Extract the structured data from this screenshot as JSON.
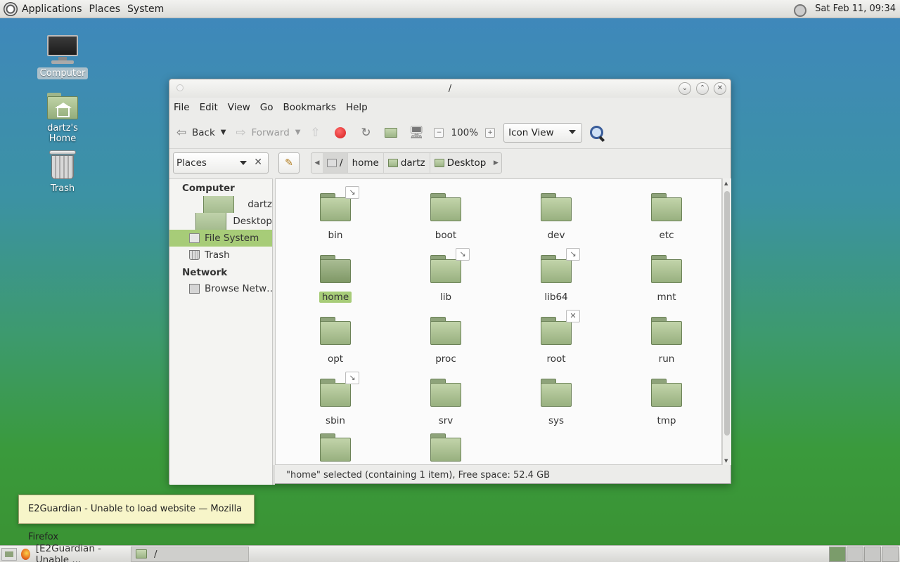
{
  "top_panel": {
    "menus": [
      "Applications",
      "Places",
      "System"
    ],
    "clock": "Sat Feb 11, 09:34"
  },
  "desktop": {
    "icons": [
      {
        "label": "Computer",
        "icon": "computer-icon",
        "selected": true
      },
      {
        "label": "dartz's Home",
        "icon": "home-folder-icon",
        "selected": false
      },
      {
        "label": "Trash",
        "icon": "trash-icon",
        "selected": false
      }
    ]
  },
  "window": {
    "title": "/",
    "menu": [
      "File",
      "Edit",
      "View",
      "Go",
      "Bookmarks",
      "Help"
    ],
    "toolbar": {
      "back_label": "Back",
      "forward_label": "Forward",
      "zoom_level": "100%",
      "view_mode": "Icon View"
    },
    "location": {
      "places_select": "Places",
      "crumbs": [
        "/",
        "home",
        "dartz",
        "Desktop"
      ]
    },
    "sidebar": {
      "computer_heading": "Computer",
      "computer_items": [
        {
          "label": "dartz",
          "icon": "home-folder-icon"
        },
        {
          "label": "Desktop",
          "icon": "desktop-folder-icon"
        },
        {
          "label": "File System",
          "icon": "drive-icon",
          "selected": true
        },
        {
          "label": "Trash",
          "icon": "trash-icon"
        }
      ],
      "network_heading": "Network",
      "network_items": [
        {
          "label": "Browse Netw…",
          "icon": "network-icon"
        }
      ]
    },
    "items": [
      {
        "name": "bin",
        "emblem": "link"
      },
      {
        "name": "boot",
        "emblem": ""
      },
      {
        "name": "dev",
        "emblem": ""
      },
      {
        "name": "etc",
        "emblem": ""
      },
      {
        "name": "home",
        "emblem": "",
        "selected": true
      },
      {
        "name": "lib",
        "emblem": "link"
      },
      {
        "name": "lib64",
        "emblem": "link"
      },
      {
        "name": "mnt",
        "emblem": ""
      },
      {
        "name": "opt",
        "emblem": ""
      },
      {
        "name": "proc",
        "emblem": ""
      },
      {
        "name": "root",
        "emblem": "no-access"
      },
      {
        "name": "run",
        "emblem": ""
      },
      {
        "name": "sbin",
        "emblem": "link"
      },
      {
        "name": "srv",
        "emblem": ""
      },
      {
        "name": "sys",
        "emblem": ""
      },
      {
        "name": "tmp",
        "emblem": ""
      },
      {
        "name": "",
        "emblem": ""
      },
      {
        "name": "",
        "emblem": ""
      }
    ],
    "status": "\"home\" selected (containing 1 item), Free space: 52.4 GB"
  },
  "tooltip": "E2Guardian - Unable to load website — Mozilla Firefox",
  "taskbar": {
    "tasks": [
      {
        "label": "[E2Guardian - Unable ...",
        "icon": "firefox-icon"
      },
      {
        "label": "/",
        "icon": "folder-icon"
      }
    ]
  }
}
